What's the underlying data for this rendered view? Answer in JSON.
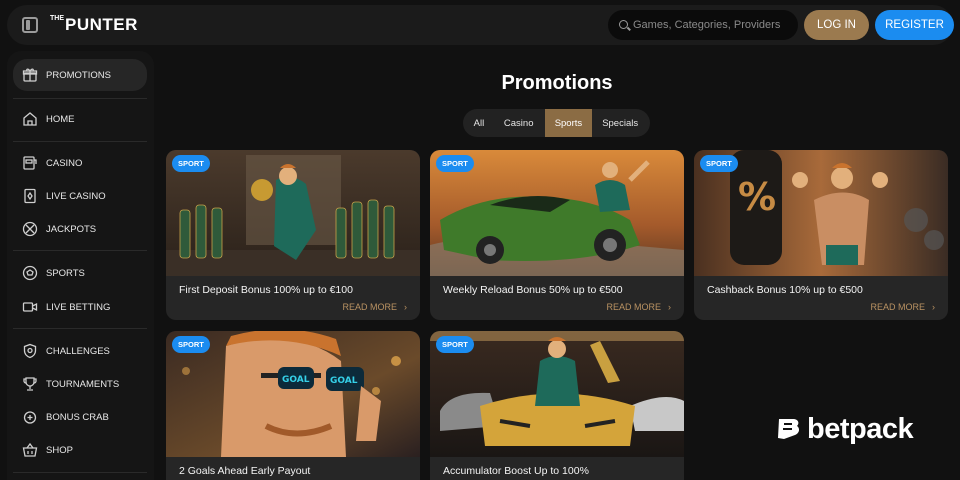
{
  "header": {
    "logo_prefix": "THE",
    "logo_text": "PUNTER",
    "search_placeholder": "Games, Categories, Providers",
    "login_label": "LOG IN",
    "register_label": "REGISTER"
  },
  "sidebar": {
    "items": [
      {
        "label": "PROMOTIONS",
        "icon": "gift-icon",
        "active": true
      },
      {
        "label": "HOME",
        "icon": "home-icon"
      },
      {
        "label": "CASINO",
        "icon": "slot-machine-icon"
      },
      {
        "label": "LIVE CASINO",
        "icon": "card-icon"
      },
      {
        "label": "JACKPOTS",
        "icon": "jackpot-icon"
      },
      {
        "label": "SPORTS",
        "icon": "soccer-ball-icon"
      },
      {
        "label": "LIVE BETTING",
        "icon": "video-camera-icon"
      },
      {
        "label": "CHALLENGES",
        "icon": "challenge-shield-icon"
      },
      {
        "label": "TOURNAMENTS",
        "icon": "trophy-icon"
      },
      {
        "label": "BONUS CRAB",
        "icon": "crab-icon"
      },
      {
        "label": "SHOP",
        "icon": "basket-icon"
      }
    ]
  },
  "main": {
    "title": "Promotions",
    "tabs": [
      {
        "label": "All"
      },
      {
        "label": "Casino"
      },
      {
        "label": "Sports",
        "active": true
      },
      {
        "label": "Specials"
      }
    ],
    "cards": [
      {
        "badge": "SPORT",
        "title": "First Deposit Bonus 100% up to €100",
        "cta": "READ MORE"
      },
      {
        "badge": "SPORT",
        "title": "Weekly Reload Bonus 50% up to €500",
        "cta": "READ MORE"
      },
      {
        "badge": "SPORT",
        "title": "Cashback Bonus 10% up to €500",
        "cta": "READ MORE"
      },
      {
        "badge": "SPORT",
        "title": "2 Goals Ahead Early Payout",
        "glasses_text": "GOAL"
      },
      {
        "badge": "SPORT",
        "title": "Accumulator Boost Up to 100%"
      }
    ]
  },
  "watermark": {
    "text": "betpack"
  },
  "colors": {
    "accent_gold": "#9b7a4f",
    "accent_blue": "#1b8cf0",
    "background": "#111111",
    "panel": "#1b1b1b"
  }
}
